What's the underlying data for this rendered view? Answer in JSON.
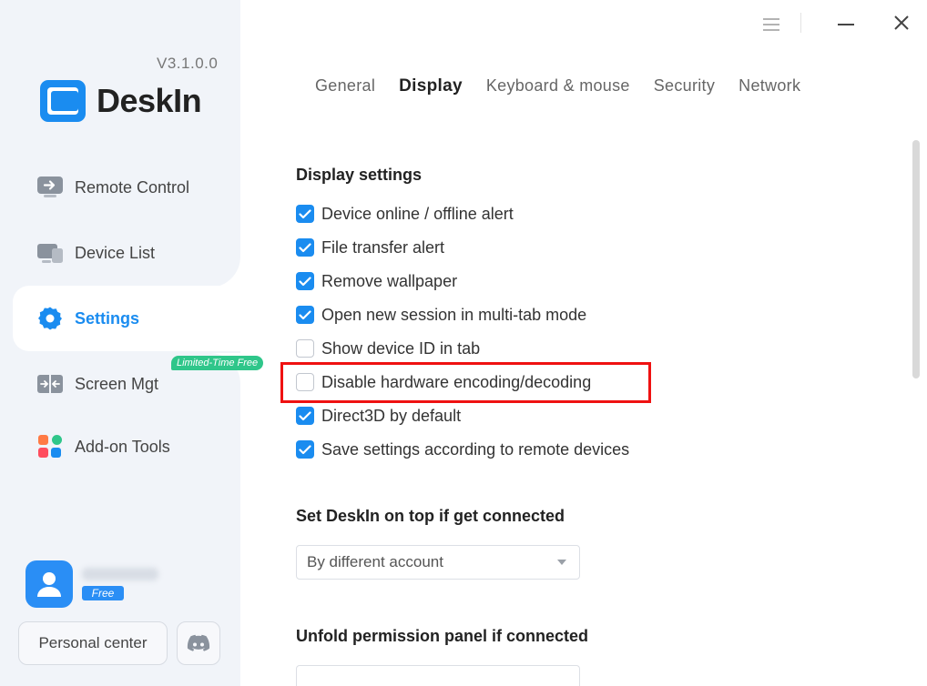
{
  "app": {
    "version": "V3.1.0.0",
    "name": "DeskIn"
  },
  "sidebar": {
    "items": [
      {
        "label": "Remote Control",
        "icon": "monitor-arrow-icon"
      },
      {
        "label": "Device List",
        "icon": "devices-icon"
      },
      {
        "label": "Settings",
        "icon": "gear-icon",
        "active": true
      },
      {
        "label": "Screen Mgt",
        "icon": "screen-split-icon",
        "badge": "Limited-Time Free"
      },
      {
        "label": "Add-on Tools",
        "icon": "apps-grid-icon"
      }
    ],
    "user": {
      "plan_badge": "Free"
    },
    "personal_center_label": "Personal center"
  },
  "tabs": [
    {
      "label": "General"
    },
    {
      "label": "Display",
      "active": true
    },
    {
      "label": "Keyboard & mouse"
    },
    {
      "label": "Security"
    },
    {
      "label": "Network"
    }
  ],
  "display_settings": {
    "title": "Display settings",
    "options": [
      {
        "label": "Device online / offline alert",
        "checked": true
      },
      {
        "label": "File transfer alert",
        "checked": true
      },
      {
        "label": "Remove wallpaper",
        "checked": true
      },
      {
        "label": "Open new session in multi-tab mode",
        "checked": true
      },
      {
        "label": "Show device ID in tab",
        "checked": false
      },
      {
        "label": "Disable hardware encoding/decoding",
        "checked": false,
        "highlighted": true
      },
      {
        "label": "Direct3D by default",
        "checked": true
      },
      {
        "label": "Save settings according to remote devices",
        "checked": true
      }
    ]
  },
  "on_top": {
    "title": "Set DeskIn on top if get connected",
    "selected": "By different account"
  },
  "permission_panel": {
    "title": "Unfold permission panel if connected"
  },
  "colors": {
    "accent": "#1a8cf0",
    "highlight_border": "#ef1111",
    "badge_green": "#2fc68a",
    "sidebar_bg": "#f1f4f9"
  }
}
